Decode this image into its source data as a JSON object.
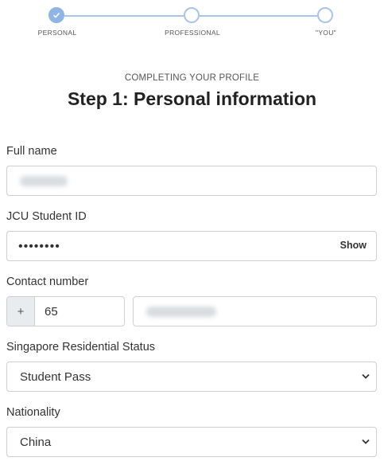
{
  "stepper": {
    "steps": [
      {
        "label": "PERSONAL",
        "state": "done"
      },
      {
        "label": "PROFESSIONAL",
        "state": "pending"
      },
      {
        "label": "\"YOU\"",
        "state": "pending"
      }
    ]
  },
  "header": {
    "eyebrow": "COMPLETING YOUR PROFILE",
    "title": "Step 1: Personal information"
  },
  "form": {
    "full_name": {
      "label": "Full name",
      "value_redacted": true
    },
    "student_id": {
      "label": "JCU Student ID",
      "masked_value": "••••••••",
      "show_label": "Show"
    },
    "contact": {
      "label": "Contact number",
      "prefix_symbol": "+",
      "country_code": "65",
      "number_redacted": true
    },
    "residential_status": {
      "label": "Singapore Residential Status",
      "selected": "Student Pass"
    },
    "nationality": {
      "label": "Nationality",
      "selected": "China"
    }
  },
  "colors": {
    "stepper_accent": "#8fb4e6",
    "border": "#cfcfcf",
    "prefix_bg": "#e9ecef"
  }
}
